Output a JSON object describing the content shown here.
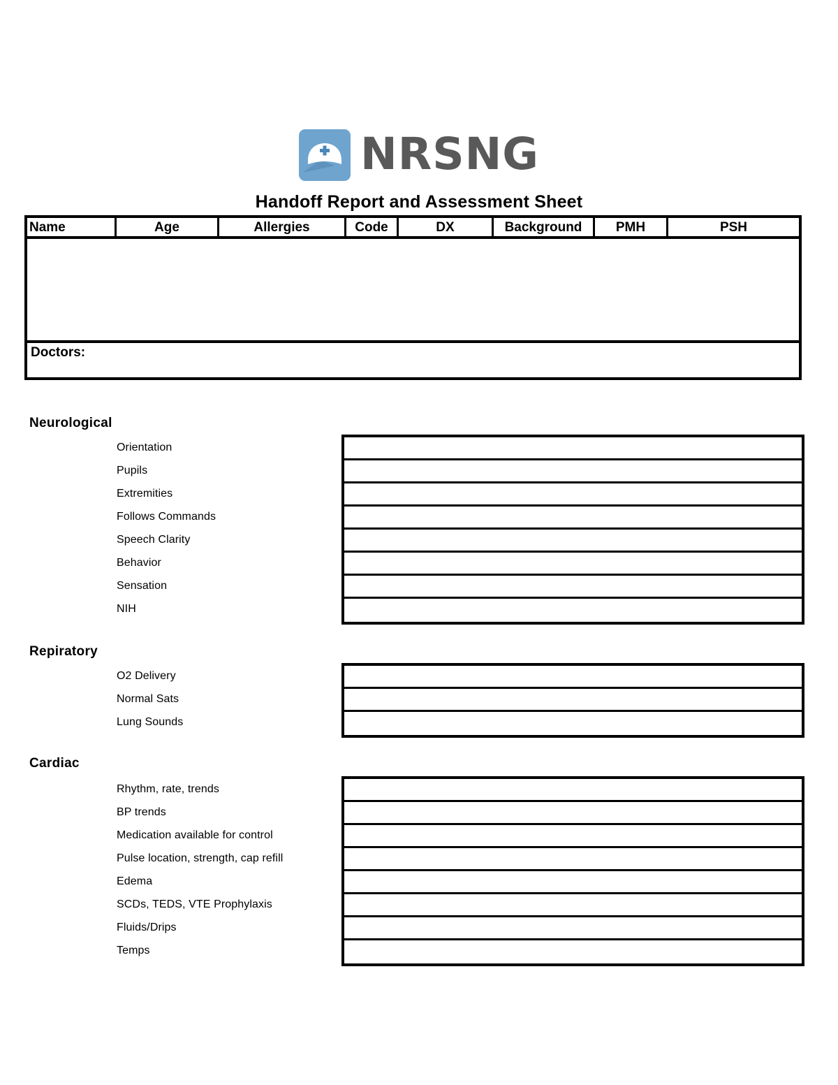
{
  "brand": {
    "wordmark": "NRSNG",
    "icon": "nurse-cap-icon",
    "icon_bg_color": "#6fa4cf",
    "wordmark_color": "#595959"
  },
  "document": {
    "title": "Handoff Report and Assessment Sheet"
  },
  "patient_table": {
    "columns": [
      {
        "label": "Name"
      },
      {
        "label": "Age"
      },
      {
        "label": "Allergies"
      },
      {
        "label": "Code"
      },
      {
        "label": "DX"
      },
      {
        "label": "Background"
      },
      {
        "label": "PMH"
      },
      {
        "label": "PSH"
      }
    ],
    "body_value": "",
    "doctors_label": "Doctors:",
    "doctors_value": ""
  },
  "sections": [
    {
      "heading": "Neurological",
      "rows": [
        {
          "label": "Orientation",
          "value": ""
        },
        {
          "label": "Pupils",
          "value": ""
        },
        {
          "label": "Extremities",
          "value": ""
        },
        {
          "label": "Follows Commands",
          "value": ""
        },
        {
          "label": "Speech Clarity",
          "value": ""
        },
        {
          "label": "Behavior",
          "value": ""
        },
        {
          "label": "Sensation",
          "value": ""
        },
        {
          "label": "NIH",
          "value": ""
        }
      ]
    },
    {
      "heading": "Repiratory",
      "rows": [
        {
          "label": "O2 Delivery",
          "value": ""
        },
        {
          "label": "Normal Sats",
          "value": ""
        },
        {
          "label": "Lung Sounds",
          "value": ""
        }
      ]
    },
    {
      "heading": "Cardiac",
      "rows": [
        {
          "label": "Rhythm, rate, trends",
          "value": ""
        },
        {
          "label": "BP trends",
          "value": ""
        },
        {
          "label": "Medication available for control",
          "value": ""
        },
        {
          "label": "Pulse location, strength, cap refill",
          "value": ""
        },
        {
          "label": "Edema",
          "value": ""
        },
        {
          "label": "SCDs, TEDS, VTE Prophylaxis",
          "value": ""
        },
        {
          "label": "Fluids/Drips",
          "value": ""
        },
        {
          "label": "Temps",
          "value": ""
        }
      ]
    }
  ]
}
